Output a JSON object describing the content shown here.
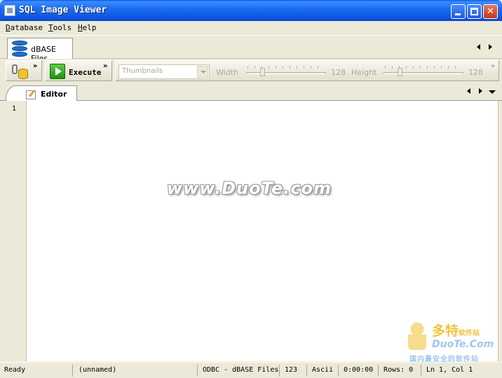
{
  "window": {
    "title": "SQL Image Viewer"
  },
  "menu": [
    "Database",
    "Tools",
    "Help"
  ],
  "connection_tab": {
    "label": "dBASE Files"
  },
  "toolbar": {
    "execute_label": "Execute",
    "chevron": "»",
    "view_select": "Thumbnails",
    "width_label": "Width",
    "width_value": "128",
    "height_label": "Height",
    "height_value": "128"
  },
  "editor_tab": {
    "label": "Editor"
  },
  "editor": {
    "line_numbers": [
      "1"
    ],
    "content": ""
  },
  "watermark": {
    "text": "www.DuoTe.com",
    "logo_cn": "多特",
    "logo_sub": "软件站",
    "logo_en": "DuoTe.Com",
    "logo_line": "国内最安全的软件站"
  },
  "statusbar": {
    "state": "Ready",
    "document": "(unnamed)",
    "connection": "ODBC - dBASE Files",
    "encoding_code": "123",
    "encoding": "Ascii",
    "time": "0:00:00",
    "rows": "Rows: 0",
    "position": "Ln 1, Col 1"
  }
}
